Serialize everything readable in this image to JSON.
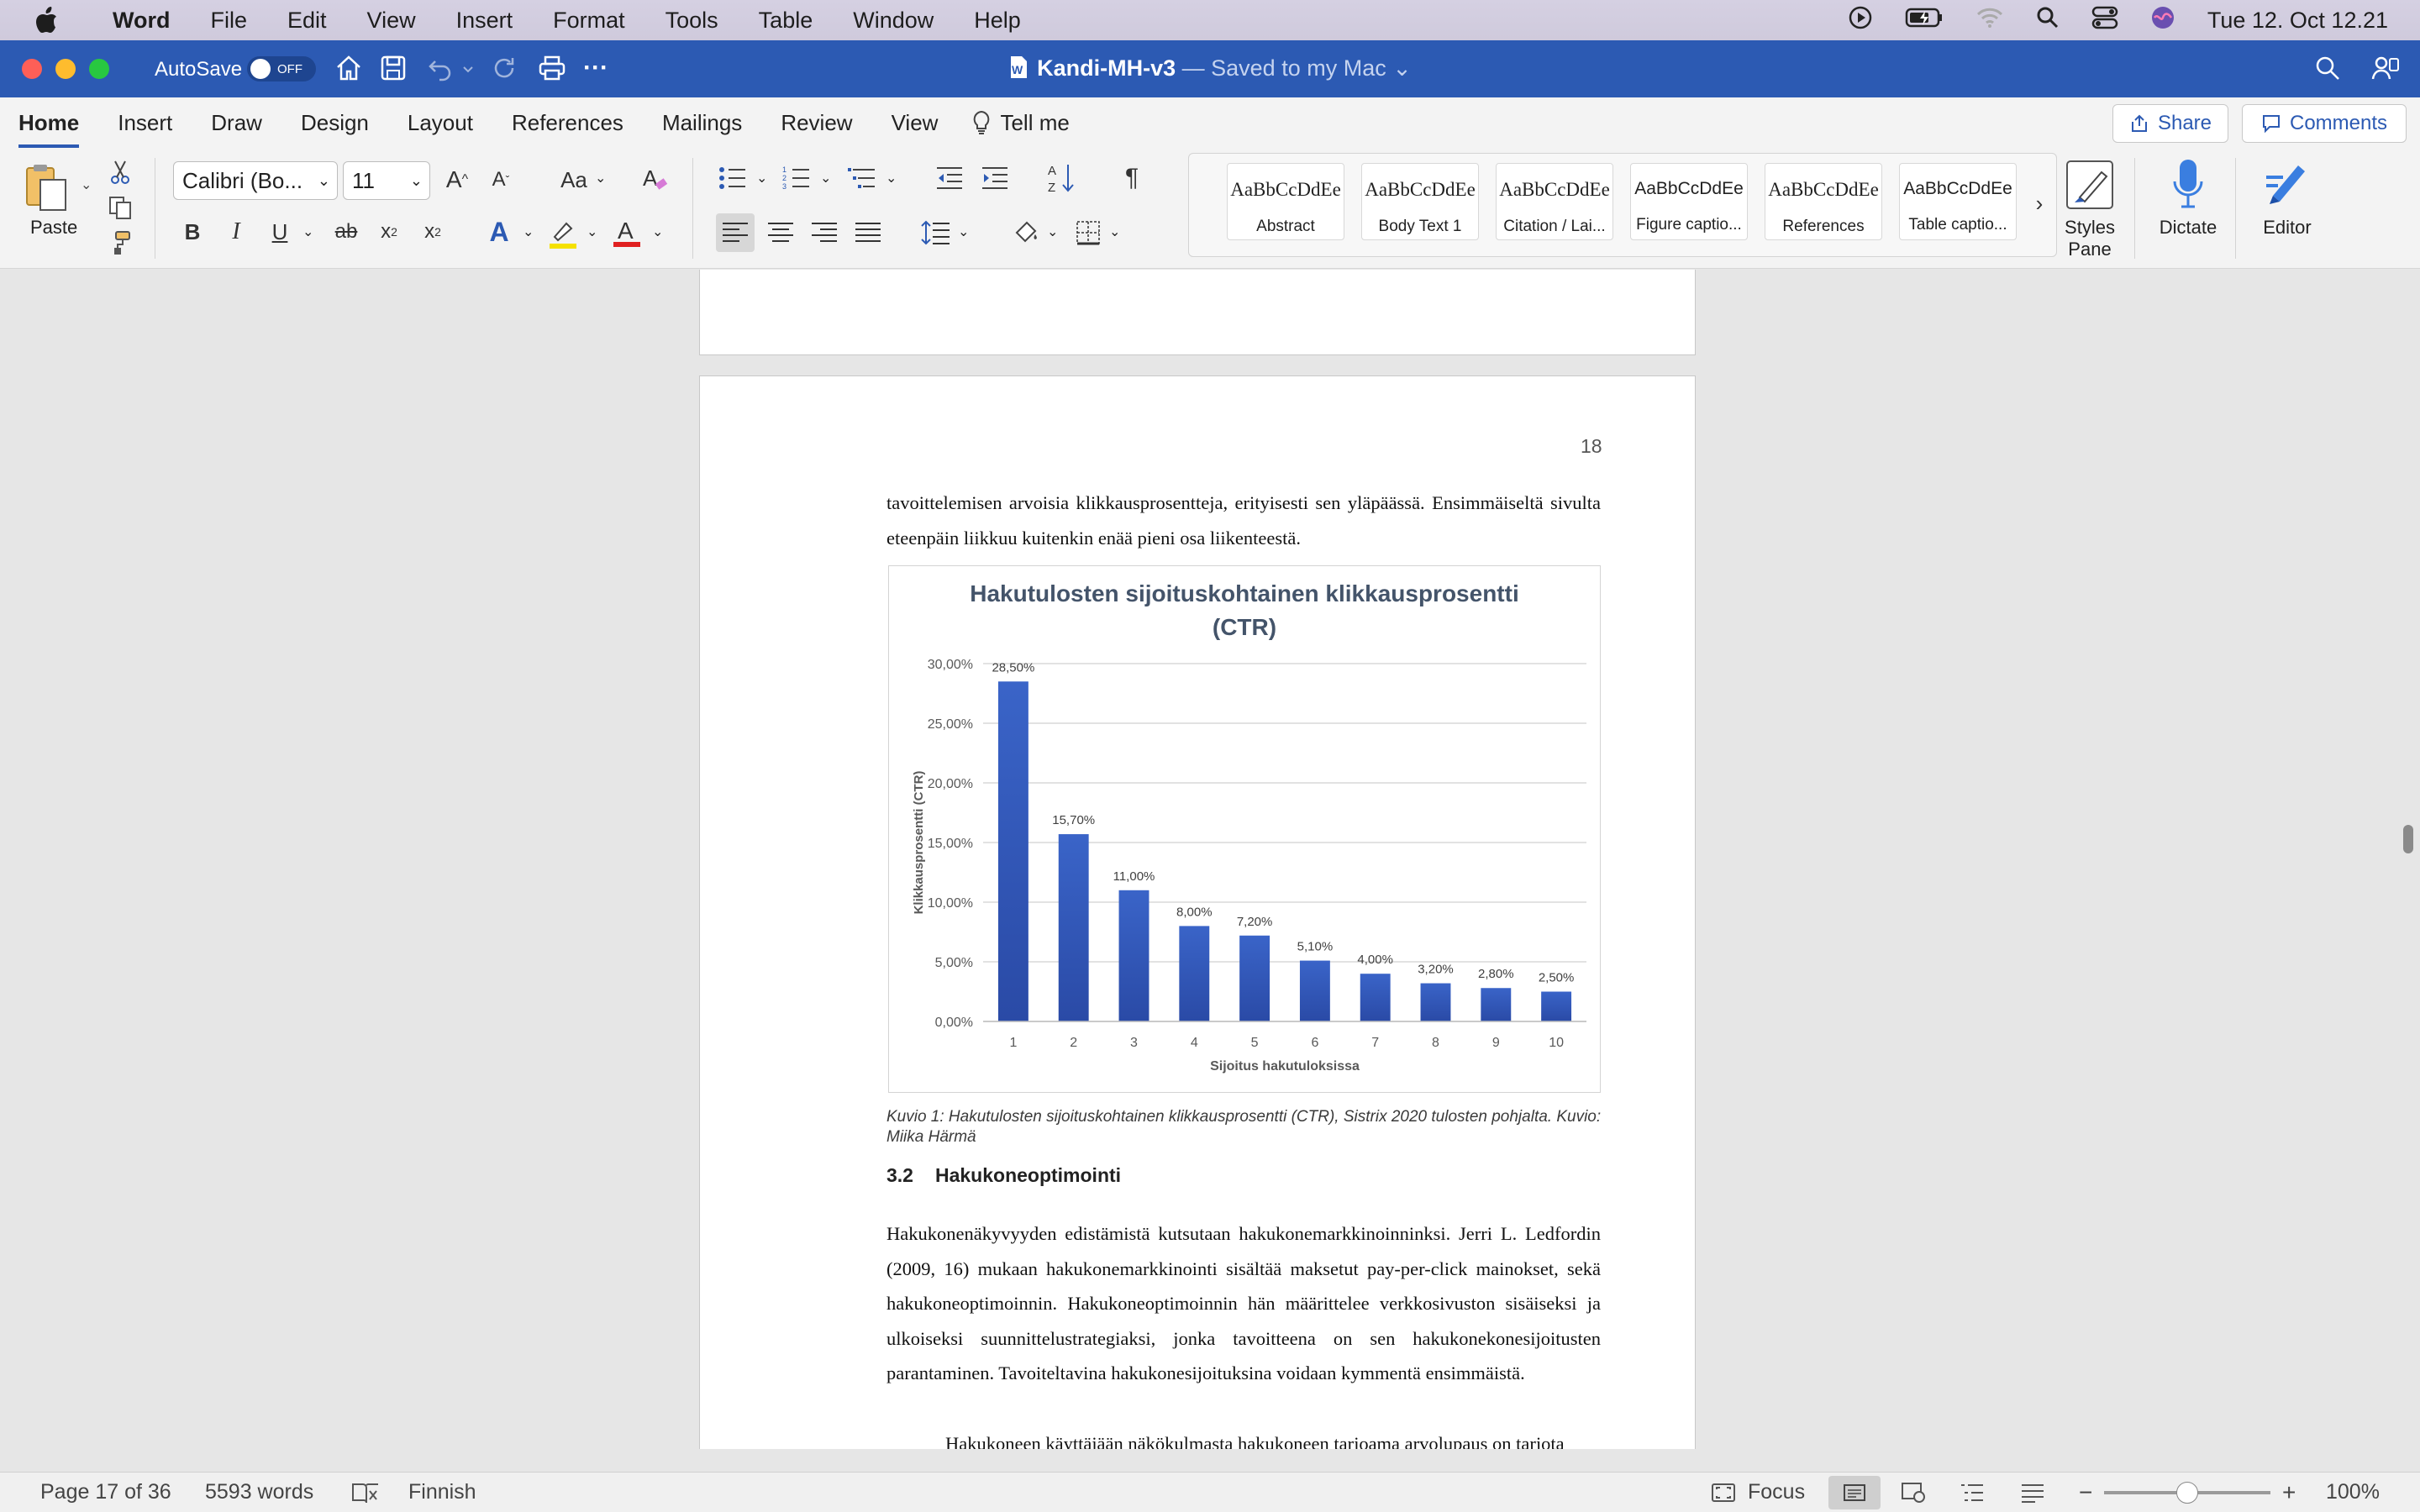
{
  "menubar": {
    "app": "Word",
    "items": [
      "File",
      "Edit",
      "View",
      "Insert",
      "Format",
      "Tools",
      "Table",
      "Window",
      "Help"
    ],
    "datetime": "Tue 12. Oct  12.21"
  },
  "titlebar": {
    "autosave_label": "AutoSave",
    "autosave_state": "OFF",
    "doc_name": "Kandi-MH-v3",
    "saved_status": "— Saved to my Mac"
  },
  "tabs": [
    "Home",
    "Insert",
    "Draw",
    "Design",
    "Layout",
    "References",
    "Mailings",
    "Review",
    "View"
  ],
  "tell_me": "Tell me",
  "share_label": "Share",
  "comments_label": "Comments",
  "ribbon": {
    "paste_label": "Paste",
    "font_name": "Calibri (Bo...",
    "font_size": "11",
    "styles": [
      {
        "preview": "AaBbCcDdEe",
        "name": "Abstract"
      },
      {
        "preview": "AaBbCcDdEe",
        "name": "Body Text 1"
      },
      {
        "preview": "AaBbCcDdEe",
        "name": "Citation / Lai..."
      },
      {
        "preview": "AaBbCcDdEe",
        "name": "Figure captio..."
      },
      {
        "preview": "AaBbCcDdEe",
        "name": "References"
      },
      {
        "preview": "AaBbCcDdEe",
        "name": "Table captio..."
      }
    ],
    "styles_pane_label": "Styles Pane",
    "dictate_label": "Dictate",
    "editor_label": "Editor",
    "accent_color": "#2c5ab3",
    "highlight_color": "#f5e100",
    "font_color": "#e02020"
  },
  "document": {
    "page_number": "18",
    "para1": "tavoittelemisen arvoisia klikkausprosentteja, erityisesti sen yläpäässä. Ensimmäiseltä sivulta eteenpäin liikkuu kuitenkin enää pieni osa liikenteestä.",
    "caption": "Kuvio 1: Hakutulosten sijoituskohtainen klikkausprosentti (CTR), Sistrix 2020 tulosten pohjalta. Kuvio: Miika Härmä",
    "heading_num": "3.2",
    "heading_text": "Hakukoneoptimointi",
    "para2": "Hakukonenäkyvyyden edistämistä kutsutaan hakukonemarkkinoinninksi. Jerri L. Ledfordin (2009, 16) mukaan hakukonemarkkinointi sisältää maksetut pay-per-click mainokset, sekä hakukoneoptimoinnin. Hakukoneoptimoinnin hän määrittelee verkkosivuston sisäiseksi ja ulkoiseksi suunnittelustrategiaksi, jonka tavoitteena on sen hakukonekonesijoitusten parantaminen. Tavoiteltavina hakukonesijoituksina voidaan kymmentä ensimmäistä.",
    "para3": "Hakukoneen käyttäjään näkökulmasta hakukoneen tarjoama arvolupaus on tarjota"
  },
  "chart_data": {
    "type": "bar",
    "title": "Hakutulosten sijoituskohtainen klikkausprosentti (CTR)",
    "xlabel": "Sijoitus hakutuloksissa",
    "ylabel": "Klikkausprosentti (CTR)",
    "categories": [
      "1",
      "2",
      "3",
      "4",
      "5",
      "6",
      "7",
      "8",
      "9",
      "10"
    ],
    "values": [
      28.5,
      15.7,
      11.0,
      8.0,
      7.2,
      5.1,
      4.0,
      3.2,
      2.8,
      2.5
    ],
    "data_labels": [
      "28,50%",
      "15,70%",
      "11,00%",
      "8,00%",
      "7,20%",
      "5,10%",
      "4,00%",
      "3,20%",
      "2,80%",
      "2,50%"
    ],
    "y_ticks": [
      "0,00%",
      "5,00%",
      "10,00%",
      "15,00%",
      "20,00%",
      "25,00%",
      "30,00%"
    ],
    "ylim": [
      0,
      30
    ],
    "grid": true,
    "bar_color": "#3a64c8"
  },
  "statusbar": {
    "page": "Page 17 of 36",
    "words": "5593 words",
    "language": "Finnish",
    "focus": "Focus",
    "zoom": "100%",
    "zoom_level": 0.5
  }
}
